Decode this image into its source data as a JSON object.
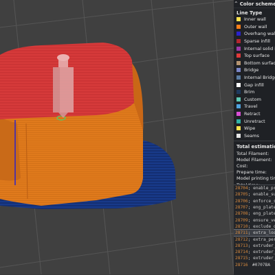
{
  "panel": {
    "title": "Color scheme",
    "collapse_icon": "chevron-up-double-icon",
    "line_type_title": "Line Type",
    "legend": [
      {
        "label": "Inner wall",
        "color": "#ffe34d"
      },
      {
        "label": "Outer wall",
        "color": "#ff7f1a"
      },
      {
        "label": "Overhang wall",
        "color": "#2a22cc"
      },
      {
        "label": "Sparse infill",
        "color": "#b3262f"
      },
      {
        "label": "Internal solid infill",
        "color": "#9b3aa8"
      },
      {
        "label": "Top surface",
        "color": "#e03a3a"
      },
      {
        "label": "Bottom surface",
        "color": "#b49470"
      },
      {
        "label": "Bridge",
        "color": "#7a85c7"
      },
      {
        "label": "Internal Bridge",
        "color": "#5a7ca0"
      },
      {
        "label": "Gap infill",
        "color": "#ffffff"
      },
      {
        "label": "Brim",
        "color": "#1e3a5f"
      },
      {
        "label": "Custom",
        "color": "#5ec9b4"
      },
      {
        "label": "Travel",
        "color": "#4fa3e0"
      },
      {
        "label": "Retract",
        "color": "#d94fd6"
      },
      {
        "label": "Unretract",
        "color": "#31b2a6"
      },
      {
        "label": "Wipe",
        "color": "#ffe34d"
      },
      {
        "label": "Seams",
        "color": "#e6e6e6"
      }
    ],
    "estimation_title": "Total estimation",
    "estimation": [
      "Total Filament:",
      "Model Filament:",
      "Cost:",
      "Prepare time:",
      "Model printing time:",
      "Total time:"
    ]
  },
  "gcode": {
    "highlighted_index": 7,
    "lines": [
      {
        "num": "28704",
        "text": "; enable_prime"
      },
      {
        "num": "28705",
        "text": "; enable_supp"
      },
      {
        "num": "28706",
        "text": "; enforce_su"
      },
      {
        "num": "28707",
        "text": "; eng_plate_"
      },
      {
        "num": "28708",
        "text": "; eng_plate_"
      },
      {
        "num": "28709",
        "text": "; ensure_ver"
      },
      {
        "num": "28710",
        "text": "; exclude_ob"
      },
      {
        "num": "28711",
        "text": "; extra_loadi"
      },
      {
        "num": "28712",
        "text": "; extra_perim"
      },
      {
        "num": "28713",
        "text": "; extruder_cl"
      },
      {
        "num": "28714",
        "text": "; extruder_cl"
      },
      {
        "num": "28715",
        "text": "; extruder_cl"
      },
      {
        "num": "28716",
        "text": "#0707BA"
      }
    ]
  }
}
